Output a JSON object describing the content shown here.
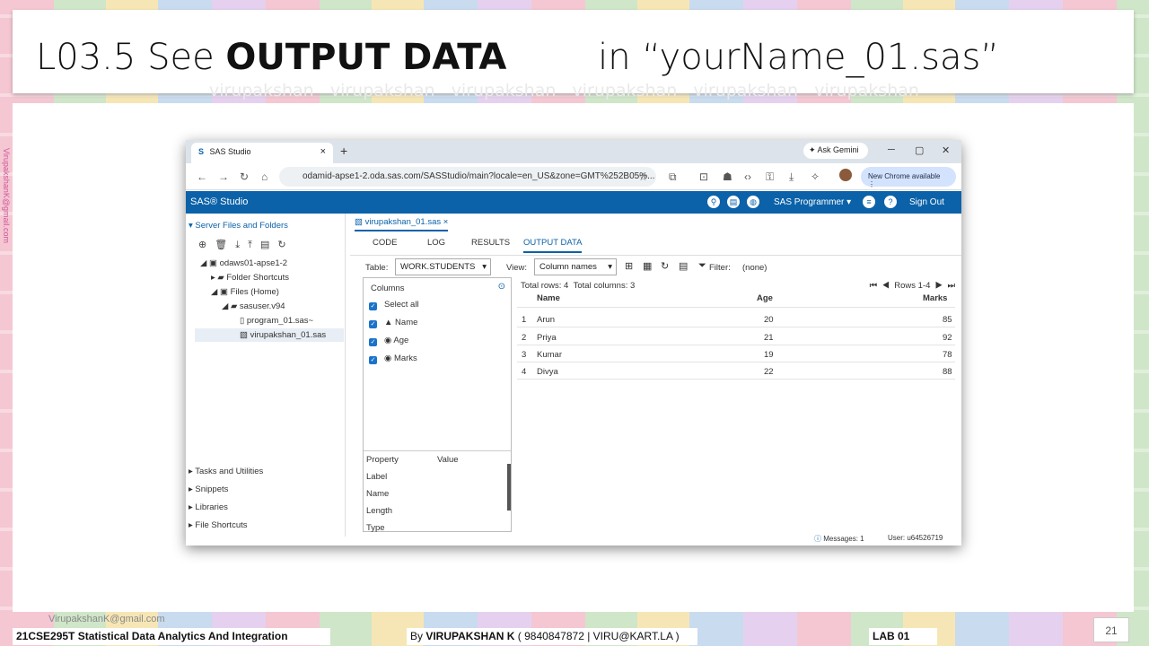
{
  "slide": {
    "title_prefix": "L03.5 See ",
    "title_bold": "OUTPUT DATA",
    "title_suffix": "        in “yourName_01.sas”",
    "side_email": "VirupakshanK@gmail.com",
    "footer_email": "VirupakshanK@gmail.com",
    "footer_course": "21CSE295T Statistical Data Analytics And Integration",
    "footer_by": "By ",
    "footer_author": "VIRUPAKSHAN K",
    "footer_contact": " ( 9840847872 | VIRU@KART.LA )",
    "footer_lab": "LAB  01",
    "page_number": "21",
    "watermark": "virupakshan"
  },
  "browser": {
    "tab_title": "SAS Studio",
    "tab_close": "×",
    "new_tab": "+",
    "gemini": "Ask Gemini",
    "url": "odamid-apse1-2.oda.sas.com/SASStudio/main?locale=en_US&zone=GMT%252B05%...",
    "chrome_available": "New Chrome available"
  },
  "sas": {
    "logo": "SAS® Studio",
    "programmer": "SAS Programmer ▾",
    "sign_out": "Sign Out",
    "left": {
      "header": "Server Files and Folders",
      "tree": [
        "odaws01-apse1-2",
        "Folder Shortcuts",
        "Files (Home)",
        "sasuser.v94",
        "program_01.sas~",
        "virupakshan_01.sas"
      ],
      "sections": [
        "Tasks and Utilities",
        "Snippets",
        "Libraries",
        "File Shortcuts"
      ]
    },
    "editor": {
      "file_tab": "virupakshan_01.sas",
      "tabs": [
        "CODE",
        "LOG",
        "RESULTS",
        "OUTPUT DATA"
      ],
      "table_label": "Table:",
      "table_value": "WORK.STUDENTS",
      "view_label": "View:",
      "view_value": "Column names",
      "filter_label": "Filter:",
      "filter_value": "(none)",
      "columns_header": "Columns",
      "select_all": "Select all",
      "columns": [
        "Name",
        "Age",
        "Marks"
      ],
      "property_headers": [
        "Property",
        "Value"
      ],
      "properties": [
        "Label",
        "Name",
        "Length",
        "Type"
      ],
      "total_rows": "Total rows: 4",
      "total_columns": "Total columns: 3",
      "rows_range": "Rows 1-4",
      "table_headers": [
        "Name",
        "Age",
        "Marks"
      ],
      "rows": [
        {
          "n": "1",
          "name": "Arun",
          "age": "20",
          "marks": "85"
        },
        {
          "n": "2",
          "name": "Priya",
          "age": "21",
          "marks": "92"
        },
        {
          "n": "3",
          "name": "Kumar",
          "age": "19",
          "marks": "78"
        },
        {
          "n": "4",
          "name": "Divya",
          "age": "22",
          "marks": "88"
        }
      ]
    },
    "status": {
      "messages": "Messages: 1",
      "user": "User: u64526719"
    }
  }
}
